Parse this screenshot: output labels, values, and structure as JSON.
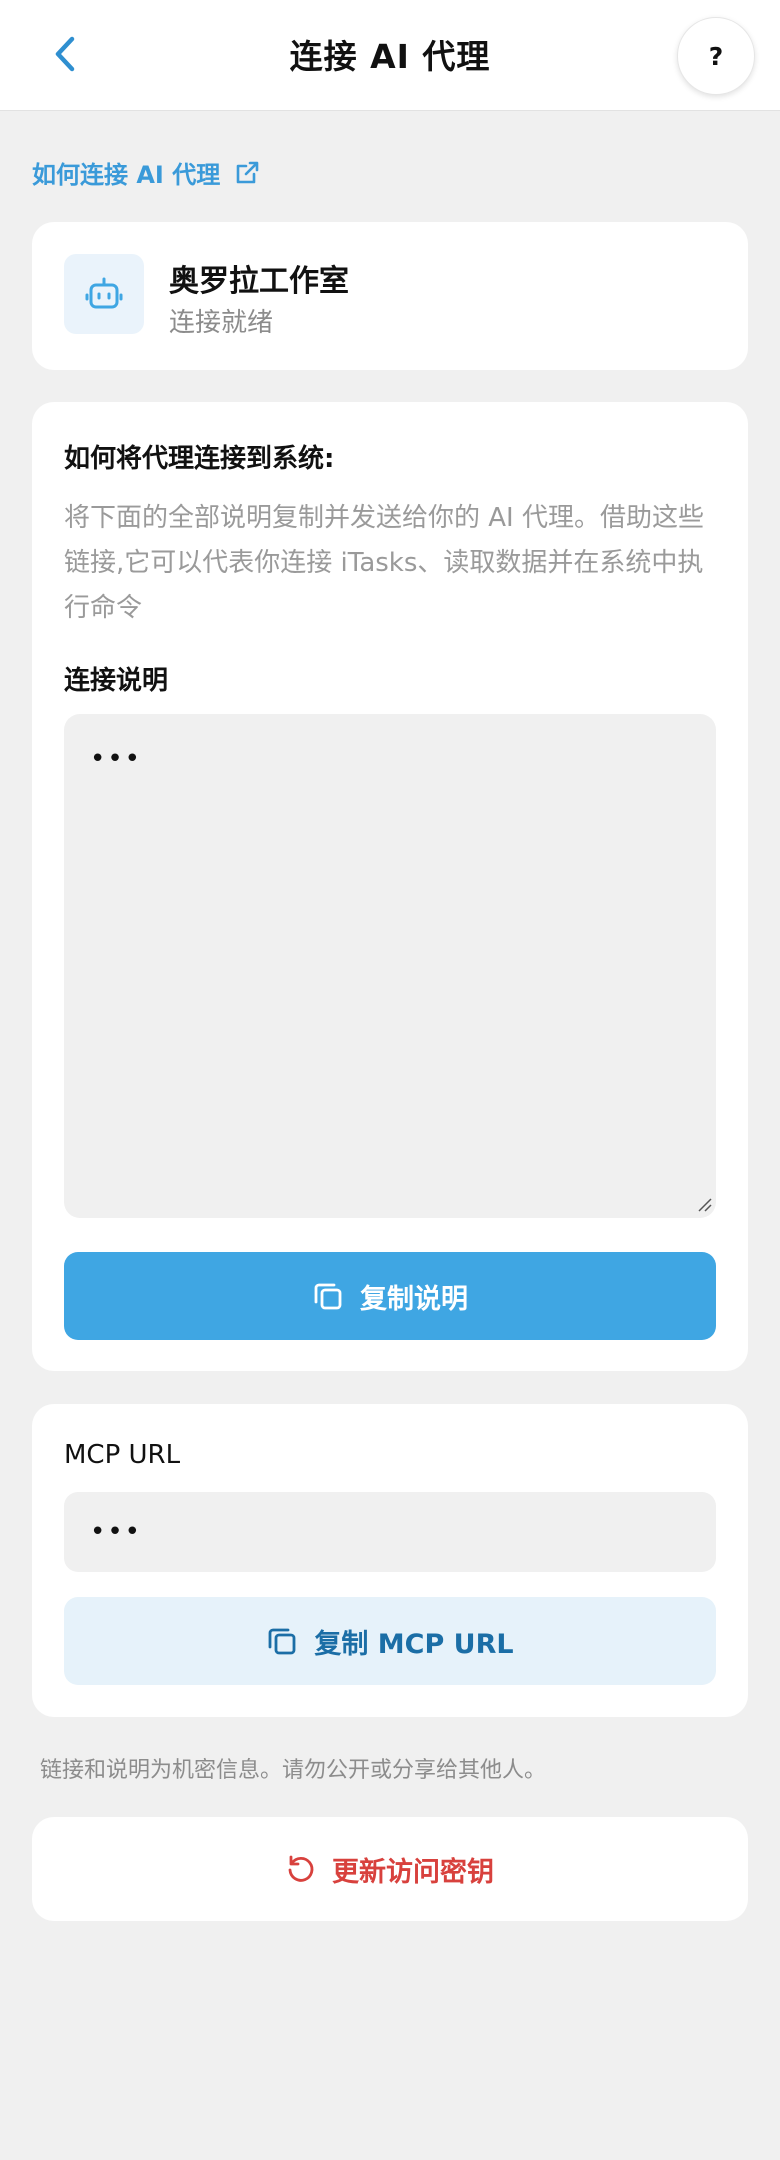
{
  "header": {
    "title": "连接 AI 代理",
    "help_label": "?"
  },
  "help_link": {
    "label": "如何连接 AI 代理"
  },
  "agent": {
    "name": "奥罗拉工作室",
    "status": "连接就绪"
  },
  "instructions": {
    "title": "如何将代理连接到系统:",
    "description": "将下面的全部说明复制并发送给你的 AI 代理。借助这些链接,它可以代表你连接 iTasks、读取数据并在系统中执行命令",
    "label": "连接说明",
    "value": "•••",
    "copy_label": "复制说明"
  },
  "mcp": {
    "label": "MCP URL",
    "value": "•••",
    "copy_label": "复制 MCP URL"
  },
  "note": "链接和说明为机密信息。请勿公开或分享给其他人。",
  "refresh": {
    "label": "更新访问密钥"
  },
  "colors": {
    "accent": "#3fa6e3",
    "link": "#3a9ad9",
    "danger": "#d8413d",
    "background": "#f0f0f0"
  },
  "icons": {
    "back": "chevron-left-icon",
    "external": "external-link-icon",
    "agent": "robot-icon",
    "copy": "copy-icon",
    "refresh": "refresh-icon"
  }
}
